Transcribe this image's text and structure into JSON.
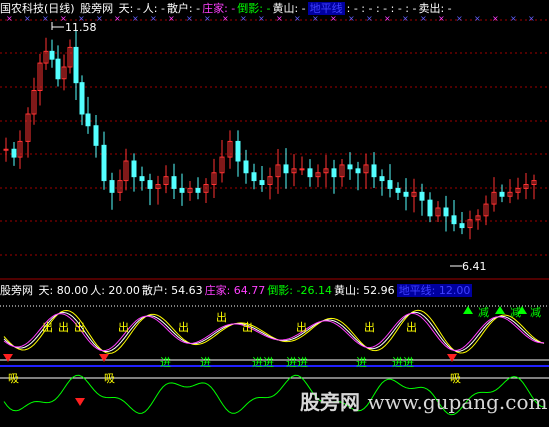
{
  "top_bar": {
    "title": "国农科技(日线)",
    "site": "股旁网",
    "items": [
      {
        "text": "天: -",
        "color": "#ffffff"
      },
      {
        "text": "人: -",
        "color": "#ffffff"
      },
      {
        "text": "散户: -",
        "color": "#ffffff"
      },
      {
        "text": "庄家: -",
        "color": "#ff40ff"
      },
      {
        "text": "倒影: -",
        "color": "#00ff00"
      },
      {
        "text": "黄山: -",
        "color": "#ffffff"
      },
      {
        "text": "地平线",
        "color": "#4040ff",
        "bg": "#0000a0"
      },
      {
        "text": ": - : - : - : - : -",
        "color": "#ffffff"
      },
      {
        "text": "卖出: -",
        "color": "#ffffff"
      }
    ]
  },
  "price_panel": {
    "high_label": "11.58",
    "low_label": "6.41",
    "colors": {
      "up": "#ff3232",
      "down": "#54ffff",
      "grid": "#a00000"
    }
  },
  "indicator_bar": {
    "site": "股旁网",
    "items": [
      {
        "text": "天: 80.00",
        "color": "#ffffff"
      },
      {
        "text": "人: 20.00",
        "color": "#ffffff"
      },
      {
        "text": "散户: 54.63",
        "color": "#ffffff"
      },
      {
        "text": "庄家: 64.77",
        "color": "#ff40ff"
      },
      {
        "text": "倒影: -26.14",
        "color": "#00ff00"
      },
      {
        "text": "黄山: 52.96",
        "color": "#ffffff"
      },
      {
        "text": "地平线: 12.00",
        "color": "#4040ff",
        "bg": "#0000a0"
      }
    ]
  },
  "indicator_panel": {
    "out_label": "出",
    "in_label": "进",
    "in_in_label": "进进",
    "absorb_label": "吸",
    "reduce_label": "减",
    "colors": {
      "white": "#ffffff",
      "yellow": "#ffff00",
      "magenta": "#ff40ff",
      "green": "#00ff00",
      "blue": "#2020ff",
      "red": "#ff2020"
    }
  },
  "watermark": {
    "cn": "股旁网",
    "url": "www.gupang.com"
  }
}
